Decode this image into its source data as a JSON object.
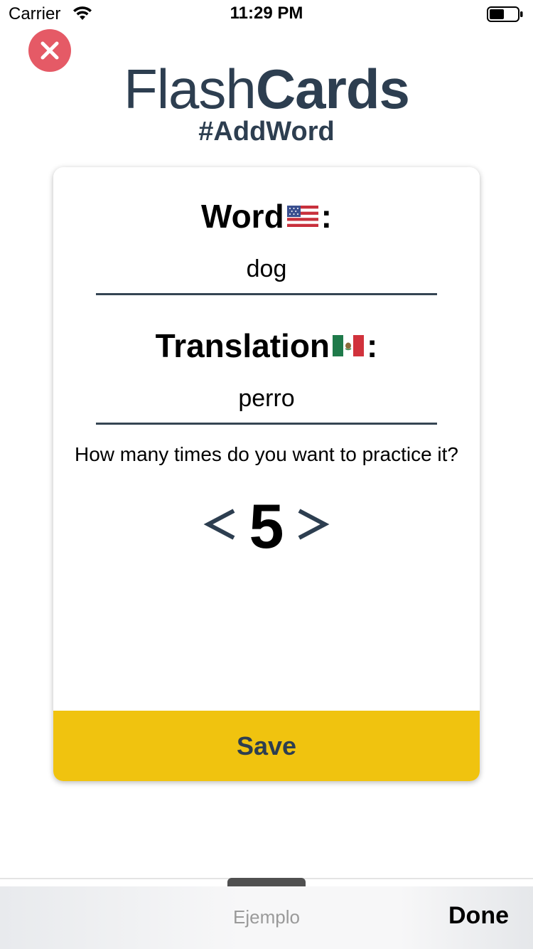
{
  "status_bar": {
    "carrier": "Carrier",
    "time": "11:29 PM",
    "icons": [
      "wifi-icon",
      "battery-icon"
    ]
  },
  "header": {
    "title_light": "Flash",
    "title_bold": "Cards",
    "subtitle": "#AddWord",
    "close_icon": "close-icon"
  },
  "form": {
    "word_label": "Word",
    "word_flag": "us-flag-icon",
    "word_value": "dog",
    "translation_label": "Translation",
    "translation_flag": "mexico-flag-icon",
    "translation_value": "perro",
    "label_suffix": ":",
    "practice_question": "How many times do you want to practice it?",
    "practice_count": "5",
    "decrement_icon": "chevron-left-icon",
    "increment_icon": "chevron-right-icon",
    "save_label": "Save"
  },
  "keyboard_toolbar": {
    "suggestion": "Ejemplo",
    "done_label": "Done"
  },
  "colors": {
    "title": "#2d3e50",
    "close_button": "#e55a66",
    "save_button": "#f0c30f",
    "underline": "#354553"
  }
}
